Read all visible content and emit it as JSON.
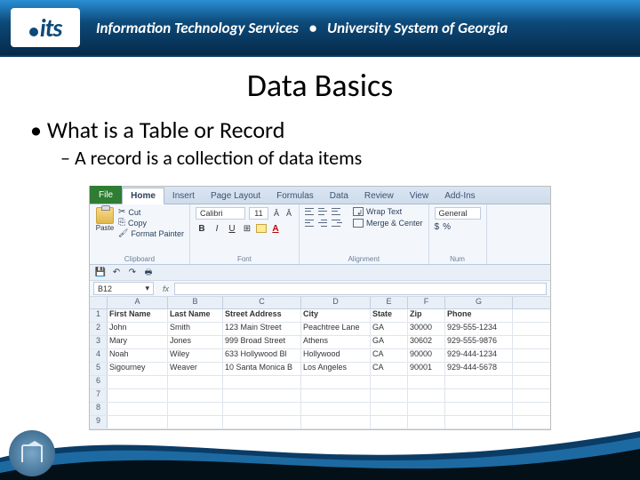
{
  "header": {
    "logo_text": "its",
    "text_left": "Information Technology Services",
    "text_right": "University System of Georgia"
  },
  "slide": {
    "title": "Data Basics",
    "bullet1": "What is a Table or Record",
    "bullet2": "A record is a collection of data items"
  },
  "excel": {
    "tabs": {
      "file": "File",
      "home": "Home",
      "insert": "Insert",
      "page_layout": "Page Layout",
      "formulas": "Formulas",
      "data": "Data",
      "review": "Review",
      "view": "View",
      "addins": "Add-Ins"
    },
    "ribbon": {
      "paste": "Paste",
      "cut": "Cut",
      "copy": "Copy",
      "format_painter": "Format Painter",
      "clipboard": "Clipboard",
      "font_name": "Calibri",
      "font_size": "11",
      "font_group": "Font",
      "wrap_text": "Wrap Text",
      "merge_center": "Merge & Center",
      "alignment": "Alignment",
      "number_format": "General",
      "number_group": "Num"
    },
    "namebox": "B12",
    "fx": "fx",
    "columns": [
      "A",
      "B",
      "C",
      "D",
      "E",
      "F",
      "G"
    ],
    "header_row": [
      "First Name",
      "Last Name",
      "Street Address",
      "City",
      "State",
      "Zip",
      "Phone"
    ],
    "rows": [
      [
        "John",
        "Smith",
        "123 Main Street",
        "Peachtree Lane",
        "GA",
        "30000",
        "929-555-1234"
      ],
      [
        "Mary",
        "Jones",
        "999 Broad Street",
        "Athens",
        "GA",
        "30602",
        "929-555-9876"
      ],
      [
        "Noah",
        "Wiley",
        "633 Hollywood Bl",
        "Hollywood",
        "CA",
        "90000",
        "929-444-1234"
      ],
      [
        "Sigourney",
        "Weaver",
        "10 Santa Monica B",
        "Los Angeles",
        "CA",
        "90001",
        "929-444-5678"
      ]
    ],
    "row_numbers": [
      "1",
      "2",
      "3",
      "4",
      "5",
      "6",
      "7",
      "8",
      "9"
    ]
  }
}
